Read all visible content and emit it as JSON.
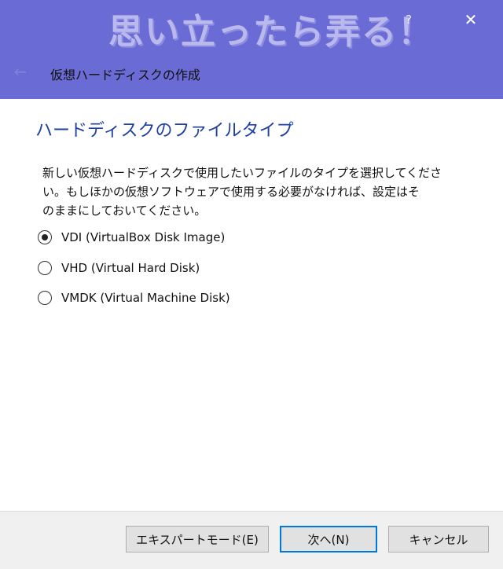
{
  "watermark": "思い立ったら弄る！",
  "titlebar": {
    "help_label": "?",
    "close_label": "✕",
    "back_icon": "arrow-left-icon"
  },
  "window_title": "仮想ハードディスクの作成",
  "section_title": "ハードディスクのファイルタイプ",
  "description_lines": [
    "新しい仮想ハードディスクで使用したいファイルのタイプを選択してくださ",
    "い。もしほかの仮想ソフトウェアで使用する必要がなければ、設定はそ",
    "のままにしておいてください。"
  ],
  "options": [
    {
      "label": "VDI (VirtualBox Disk Image)",
      "selected": true
    },
    {
      "label": "VHD (Virtual Hard Disk)",
      "selected": false
    },
    {
      "label": "VMDK (Virtual Machine Disk)",
      "selected": false
    }
  ],
  "buttons": {
    "expert": "エキスパートモード(E)",
    "next": "次へ(N)",
    "cancel": "キャンセル"
  },
  "colors": {
    "header": "#6b6bd6",
    "section_title": "#1f3fa3",
    "primary_border": "#0078d7"
  }
}
